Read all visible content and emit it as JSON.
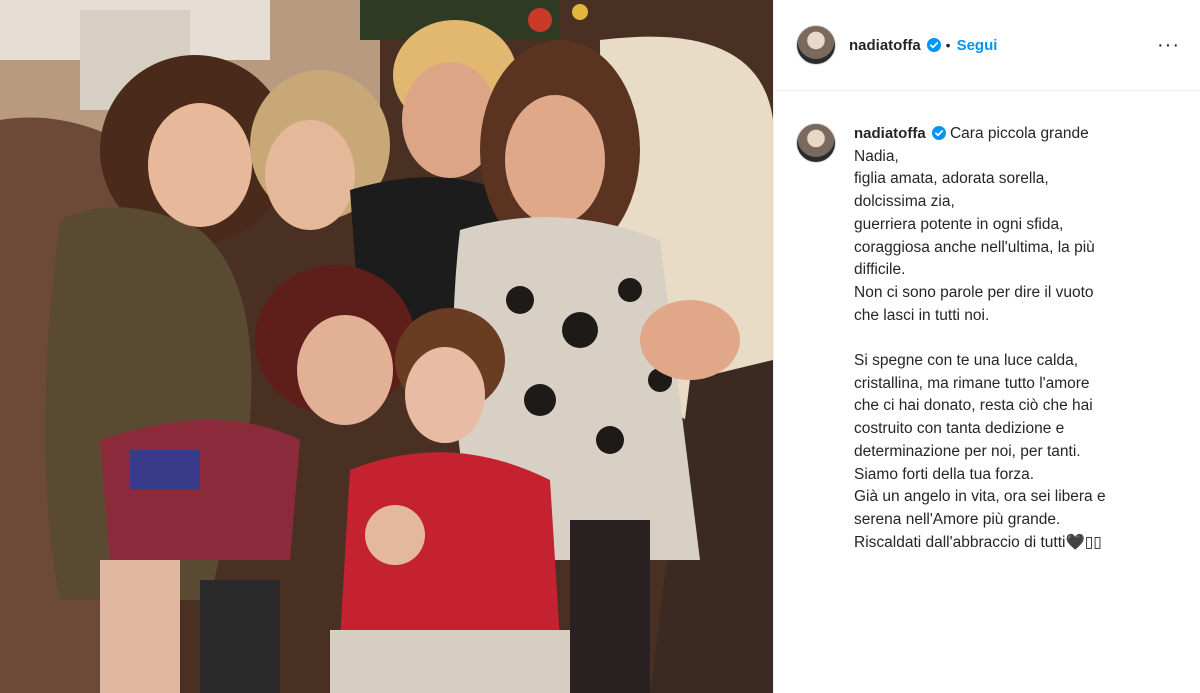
{
  "post": {
    "username": "nadiatoffa",
    "follow_label": "Segui",
    "separator": "•",
    "more_label": "···",
    "verified_icon": "verified-badge-icon",
    "accent_color": "#0095f6",
    "caption_lines": [
      "Cara piccola grande",
      "Nadia,",
      "figlia amata, adorata sorella,",
      "dolcissima zia,",
      "guerriera potente in ogni sfida,",
      "coraggiosa anche nell'ultima, la più",
      "difficile.",
      "Non ci sono parole per dire il vuoto",
      "che lasci in tutti noi.",
      "",
      "Si spegne con te una luce calda,",
      "cristallina, ma rimane tutto l'amore",
      "che ci hai donato, resta ciò che hai",
      "costruito con tanta dedizione e",
      "determinazione per noi, per tanti.",
      "Siamo forti della tua forza.",
      "Già un angelo in vita, ora sei libera e",
      "serena nell'Amore più grande.",
      "Riscaldati dall'abbraccio di tutti🖤▯▯"
    ]
  }
}
